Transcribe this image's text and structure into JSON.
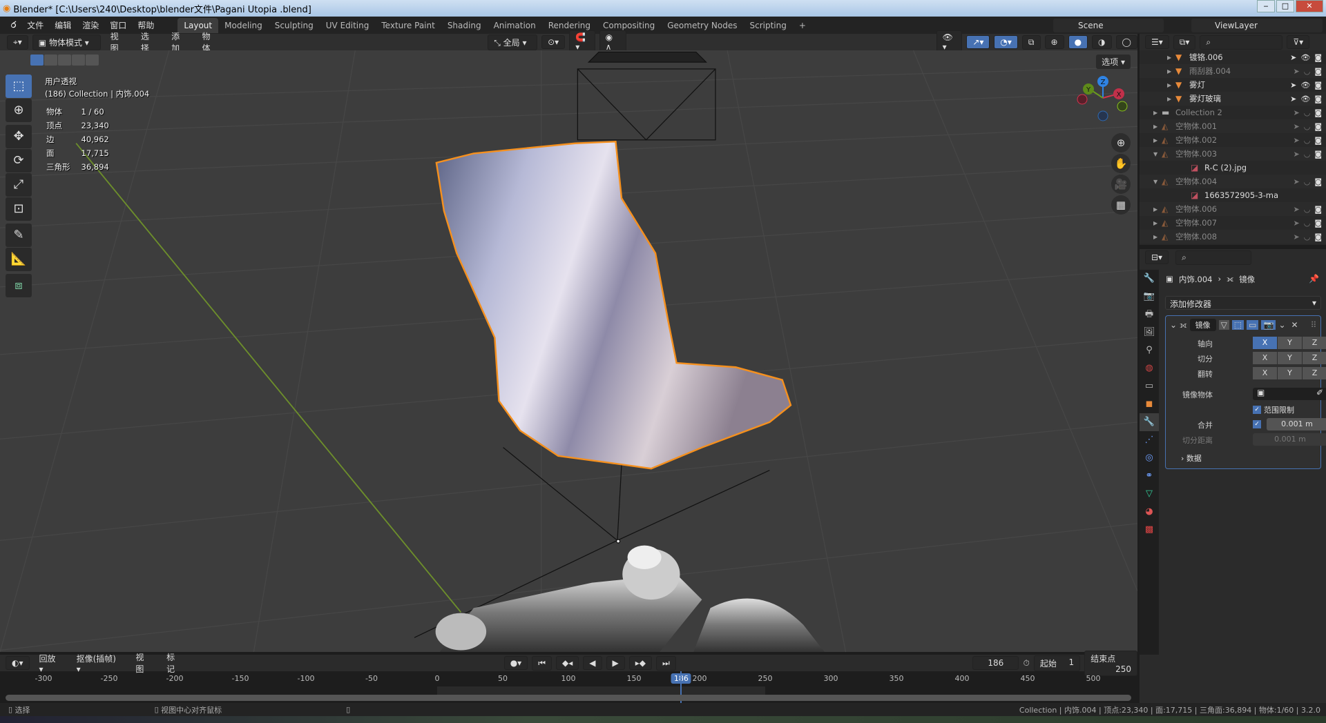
{
  "window": {
    "title": "Blender* [C:\\Users\\240\\Desktop\\blender文件\\Pagani Utopia .blend]"
  },
  "menu": {
    "items": [
      "文件",
      "编辑",
      "渲染",
      "窗口",
      "帮助"
    ]
  },
  "workspaces": {
    "tabs": [
      "Layout",
      "Modeling",
      "Sculpting",
      "UV Editing",
      "Texture Paint",
      "Shading",
      "Animation",
      "Rendering",
      "Compositing",
      "Geometry Nodes",
      "Scripting",
      "+"
    ],
    "active": "Layout"
  },
  "scene": {
    "name": "Scene",
    "view_layer": "ViewLayer"
  },
  "viewport_header": {
    "mode": "物体模式",
    "menus": [
      "视图",
      "选择",
      "添加",
      "物体"
    ],
    "transform_orientation": "全局",
    "options_label": "选项"
  },
  "viewport": {
    "view_name": "用户透视",
    "collection_line": "(186) Collection | 内饰.004",
    "stats": [
      {
        "label": "物体",
        "value": "1 / 60"
      },
      {
        "label": "顶点",
        "value": "23,340"
      },
      {
        "label": "边",
        "value": "40,962"
      },
      {
        "label": "面",
        "value": "17,715"
      },
      {
        "label": "三角形",
        "value": "36,894"
      }
    ],
    "gizmo": {
      "z": "Z",
      "y": "Y",
      "x": "X"
    },
    "tools": [
      "select-box-icon",
      "cursor-icon",
      "move-icon",
      "rotate-icon",
      "scale-icon",
      "transform-icon",
      "annotate-icon",
      "measure-icon",
      "add-cube-icon"
    ],
    "selected_outline_color": "#f5901e"
  },
  "outliner": {
    "rows": [
      {
        "name": "镀铬.006",
        "type": "mesh",
        "expanded": false,
        "dim": false,
        "visible": true
      },
      {
        "name": "雨刮器.004",
        "type": "mesh",
        "expanded": false,
        "dim": true,
        "visible": false
      },
      {
        "name": "雾灯",
        "type": "mesh",
        "expanded": false,
        "dim": false,
        "visible": true
      },
      {
        "name": "雾灯玻璃",
        "type": "mesh",
        "expanded": false,
        "dim": false,
        "visible": true
      },
      {
        "name": "Collection 2",
        "type": "collection",
        "badge": "5",
        "expanded": false,
        "dim": true,
        "visible": false
      },
      {
        "name": "空物体.001",
        "type": "empty",
        "expanded": false,
        "dim": true,
        "visible": false
      },
      {
        "name": "空物体.002",
        "type": "empty",
        "expanded": false,
        "dim": true,
        "visible": false
      },
      {
        "name": "空物体.003",
        "type": "empty",
        "expanded": true,
        "dim": true,
        "visible": false
      },
      {
        "name": "R-C (2).jpg",
        "type": "image",
        "child": true
      },
      {
        "name": "空物体.004",
        "type": "empty",
        "expanded": true,
        "dim": true,
        "visible": false
      },
      {
        "name": "1663572905-3-ma",
        "type": "image",
        "child": true
      },
      {
        "name": "空物体.006",
        "type": "empty",
        "expanded": false,
        "dim": true,
        "visible": false
      },
      {
        "name": "空物体.007",
        "type": "empty",
        "expanded": false,
        "dim": true,
        "visible": false
      },
      {
        "name": "空物体.008",
        "type": "empty",
        "expanded": false,
        "dim": true,
        "visible": false
      }
    ]
  },
  "properties": {
    "object": "内饰.004",
    "modifier_crumb": "镜像",
    "add_modifier": "添加修改器",
    "modifier": {
      "name": "镜像",
      "axis_label": "轴向",
      "bisect_label": "切分",
      "flip_label": "翻转",
      "axes": [
        "X",
        "Y",
        "Z"
      ],
      "axis_on": [
        true,
        false,
        false
      ],
      "bisect_on": [
        false,
        false,
        false
      ],
      "flip_on": [
        false,
        false,
        false
      ],
      "mirror_object_label": "镜像物体",
      "clipping_label": "范围限制",
      "clipping": true,
      "merge_label": "合并",
      "merge": true,
      "merge_value": "0.001 m",
      "bisect_distance_label": "切分距离",
      "bisect_distance_value": "0.001 m",
      "data_label": "数据"
    }
  },
  "timeline": {
    "menus": [
      "回放",
      "抠像(插帧)",
      "视图",
      "标记"
    ],
    "current_frame": "186",
    "start_label": "起始",
    "start": "1",
    "end_label": "结束点",
    "end": "250",
    "ticks": [
      -300,
      -250,
      -200,
      -150,
      -100,
      -50,
      0,
      50,
      100,
      150,
      200,
      250,
      300,
      350,
      400,
      450,
      500
    ]
  },
  "statusbar": {
    "left": "选择",
    "middle": "视图中心对齐鼠标",
    "right": "Collection | 内饰.004 | 顶点:23,340 | 面:17,715 | 三角面:36,894 | 物体:1/60 | 3.2.0"
  }
}
